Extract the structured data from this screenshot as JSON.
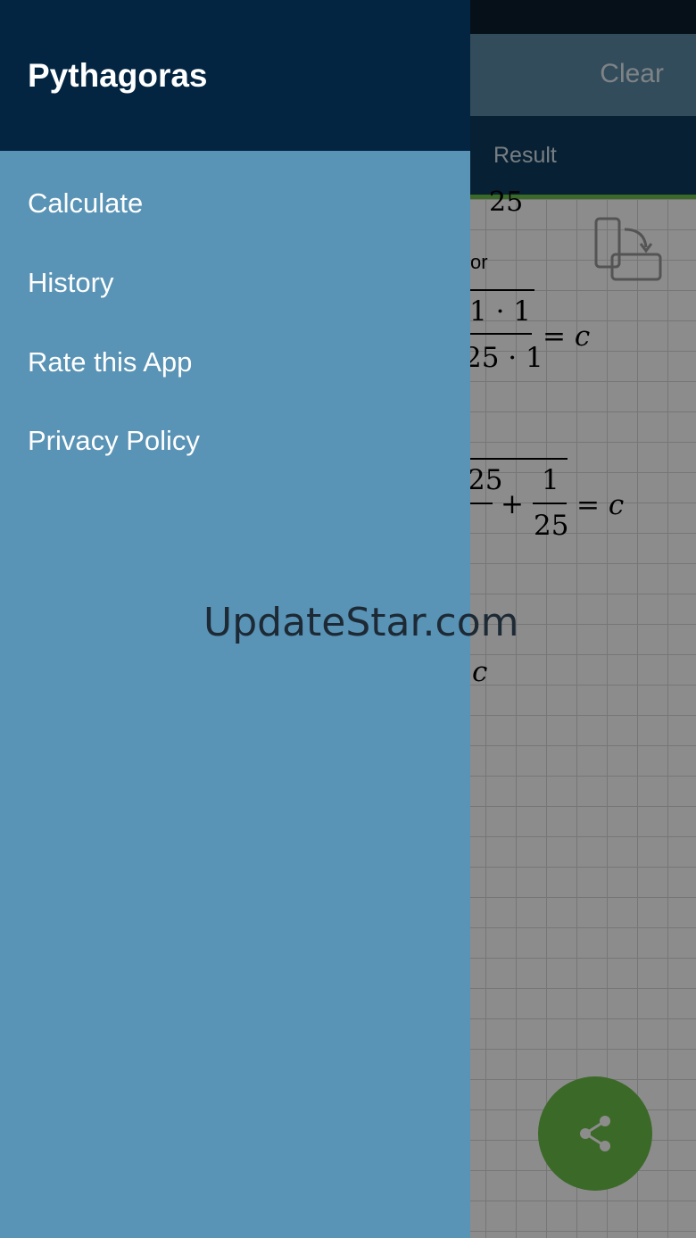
{
  "app": {
    "toolbar": {
      "clear_label": "Clear"
    },
    "tabs": {
      "result_label": "Result"
    },
    "content": {
      "partial_number_top": "25",
      "or_label": "or",
      "eq1": {
        "numerator": "1 · 1",
        "denominator": "25 · 1",
        "rhs": "= c"
      },
      "eq2": {
        "left_numerator": "25",
        "plus": "+",
        "right_numerator": "1",
        "right_denominator": "25",
        "rhs": "= c"
      },
      "eq3": {
        "rhs": "c"
      }
    },
    "fab": {
      "icon": "share-icon"
    }
  },
  "drawer": {
    "title": "Pythagoras",
    "items": [
      {
        "label": "Calculate"
      },
      {
        "label": "History"
      },
      {
        "label": "Rate this App"
      },
      {
        "label": "Privacy Policy"
      }
    ]
  },
  "watermark": "UpdateStar.com",
  "colors": {
    "drawer_header": "#032541",
    "drawer_body": "#5993b5",
    "toolbar": "#5b8aa8",
    "tabbar": "#0d3b5e",
    "accent_green": "#6cc04a"
  }
}
